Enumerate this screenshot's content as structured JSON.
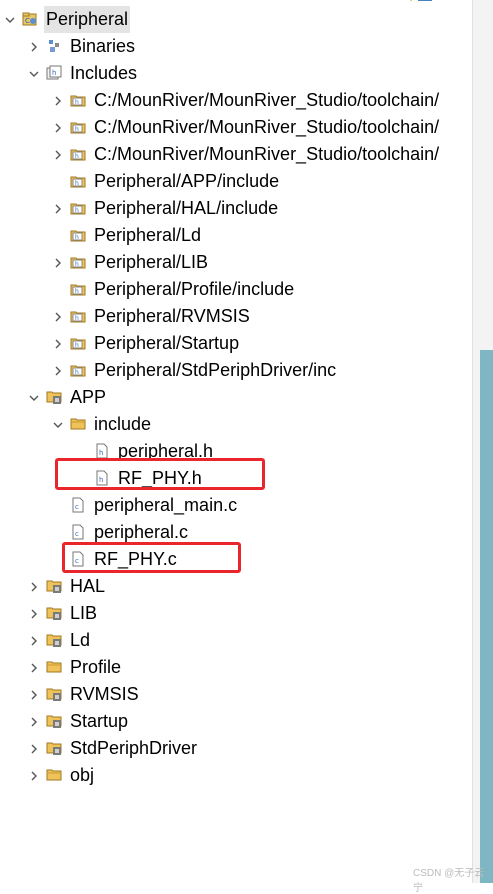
{
  "tree": {
    "items": [
      {
        "label": "Peripheral",
        "expanded": true,
        "icon": "project-icon",
        "selected": true
      },
      {
        "label": "Binaries",
        "expanded": false,
        "icon": "binaries-icon"
      },
      {
        "label": "Includes",
        "expanded": true,
        "icon": "includes-icon"
      },
      {
        "label": "C:/MounRiver/MounRiver_Studio/toolchain/",
        "expanded": false,
        "icon": "include-folder-icon"
      },
      {
        "label": "C:/MounRiver/MounRiver_Studio/toolchain/",
        "expanded": false,
        "icon": "include-folder-icon"
      },
      {
        "label": "C:/MounRiver/MounRiver_Studio/toolchain/",
        "expanded": false,
        "icon": "include-folder-icon"
      },
      {
        "label": "Peripheral/APP/include",
        "icon": "include-folder-icon"
      },
      {
        "label": "Peripheral/HAL/include",
        "expanded": false,
        "icon": "include-folder-icon"
      },
      {
        "label": "Peripheral/Ld",
        "icon": "include-folder-icon"
      },
      {
        "label": "Peripheral/LIB",
        "expanded": false,
        "icon": "include-folder-icon"
      },
      {
        "label": "Peripheral/Profile/include",
        "icon": "include-folder-icon"
      },
      {
        "label": "Peripheral/RVMSIS",
        "expanded": false,
        "icon": "include-folder-icon"
      },
      {
        "label": "Peripheral/Startup",
        "expanded": false,
        "icon": "include-folder-icon"
      },
      {
        "label": "Peripheral/StdPeriphDriver/inc",
        "expanded": false,
        "icon": "include-folder-icon"
      },
      {
        "label": "APP",
        "expanded": true,
        "icon": "source-folder-icon"
      },
      {
        "label": "include",
        "expanded": true,
        "icon": "folder-icon"
      },
      {
        "label": "peripheral.h",
        "icon": "header-file-icon"
      },
      {
        "label": "RF_PHY.h",
        "icon": "header-file-icon"
      },
      {
        "label": "peripheral_main.c",
        "icon": "c-file-icon"
      },
      {
        "label": "peripheral.c",
        "icon": "c-file-icon"
      },
      {
        "label": "RF_PHY.c",
        "icon": "c-file-icon"
      },
      {
        "label": "HAL",
        "expanded": false,
        "icon": "source-folder-icon"
      },
      {
        "label": "LIB",
        "expanded": false,
        "icon": "source-folder-icon"
      },
      {
        "label": "Ld",
        "expanded": false,
        "icon": "source-folder-icon"
      },
      {
        "label": "Profile",
        "expanded": false,
        "icon": "folder-icon"
      },
      {
        "label": "RVMSIS",
        "expanded": false,
        "icon": "source-folder-icon"
      },
      {
        "label": "Startup",
        "expanded": false,
        "icon": "source-folder-icon"
      },
      {
        "label": "StdPeriphDriver",
        "expanded": false,
        "icon": "source-folder-icon"
      },
      {
        "label": "obj",
        "expanded": false,
        "icon": "folder-icon"
      }
    ]
  },
  "watermark": "CSDN @无子云宁",
  "colors": {
    "highlight": "#e8262b",
    "selection": "#e4e4e4",
    "scrollbar": "#7fb6c4"
  }
}
